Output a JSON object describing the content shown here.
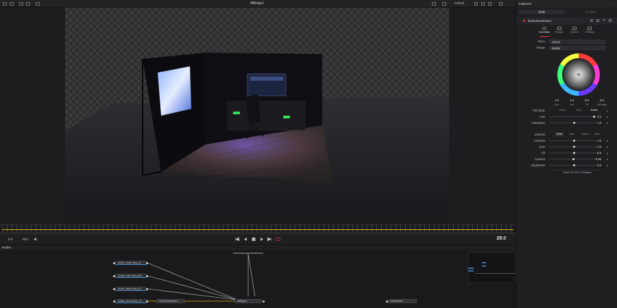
{
  "topbar": {
    "title": "dMerge1",
    "viewer_preset": "Default"
  },
  "inspector": {
    "header": "Inspector",
    "tabs": [
      "Tools",
      "Modifiers"
    ],
    "tool": {
      "name": "dColorCorrector1"
    },
    "subtabs": [
      "Correction",
      "Ranges",
      "Options",
      "Settings"
    ],
    "menu": {
      "label": "Menu",
      "value": "Colors"
    },
    "range": {
      "label": "Range",
      "value": "Master"
    },
    "wheel_values": [
      {
        "value": "1.0",
        "label": "Hue"
      },
      {
        "value": "1.0",
        "label": "Sat"
      },
      {
        "value": "0.0",
        "label": "Tilt"
      },
      {
        "value": "0.0",
        "label": "Strength"
      }
    ],
    "tint_mode": {
      "label": "Tint Mode",
      "options": [
        "Fast",
        "Full",
        "Better"
      ],
      "active": 2
    },
    "hue": {
      "label": "Hue",
      "value": "1.0",
      "level": 0.92
    },
    "saturation": {
      "label": "Saturation",
      "value": "1.0",
      "level": 0.5
    },
    "channel": {
      "label": "Channel",
      "options": [
        "RGB",
        "Red",
        "Green",
        "Blue"
      ],
      "active": 0
    },
    "contrast": {
      "label": "Contrast",
      "value": "1.0",
      "level": 0.5
    },
    "gain": {
      "label": "Gain",
      "value": "1.0",
      "level": 0.5
    },
    "lift": {
      "label": "Lift",
      "value": "0.0",
      "level": 0.5
    },
    "gamma": {
      "label": "Gamma",
      "value": "0.96",
      "level": 0.48
    },
    "brightness": {
      "label": "Brightness",
      "value": "0.0",
      "level": 0.5
    },
    "reset_label": "Reset All Color Changes"
  },
  "transport": {
    "start": "0.0",
    "end": "79.0",
    "current_frame": "28.0"
  },
  "nodes": {
    "title": "Nodes",
    "items": [
      {
        "label": "studio_chair-deep_[0..."
      },
      {
        "label": "studio_sofa-deep_[00..."
      },
      {
        "label": "studio_desk-deep_[0..."
      },
      {
        "label": "studio_neon-deep_[0..."
      },
      {
        "label": "dColorCorrector1"
      },
      {
        "label": "dMerge1"
      },
      {
        "label": "MediaOut1"
      }
    ]
  },
  "colors": {
    "accent_red": "#e0343b",
    "link_yellow": "#e0b300",
    "media_blue": "#4a90d9"
  }
}
